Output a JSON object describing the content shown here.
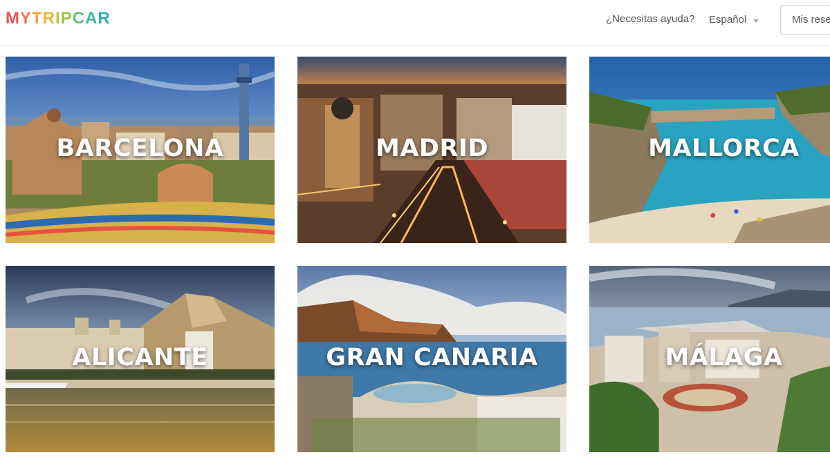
{
  "header": {
    "logo_letters": [
      {
        "char": "M",
        "color": "#e8524f"
      },
      {
        "char": "Y",
        "color": "#ee7a4a"
      },
      {
        "char": "T",
        "color": "#f4a63d"
      },
      {
        "char": "R",
        "color": "#e9b63b"
      },
      {
        "char": "I",
        "color": "#c3bb3e"
      },
      {
        "char": "P",
        "color": "#9cc04c"
      },
      {
        "char": "C",
        "color": "#5fbf86"
      },
      {
        "char": "A",
        "color": "#3bb8a6"
      },
      {
        "char": "R",
        "color": "#31b0b8"
      }
    ],
    "help_label": "¿Necesitas ayuda?",
    "language_label": "Español",
    "bookings_label": "Mis reservas"
  },
  "destinations": [
    {
      "name": "BARCELONA",
      "scene": "city-park"
    },
    {
      "name": "MADRID",
      "scene": "city-night"
    },
    {
      "name": "MALLORCA",
      "scene": "cove"
    },
    {
      "name": "ALICANTE",
      "scene": "harbor"
    },
    {
      "name": "GRAN CANARIA",
      "scene": "coast-cliffs"
    },
    {
      "name": "MÁLAGA",
      "scene": "city-bay"
    }
  ]
}
